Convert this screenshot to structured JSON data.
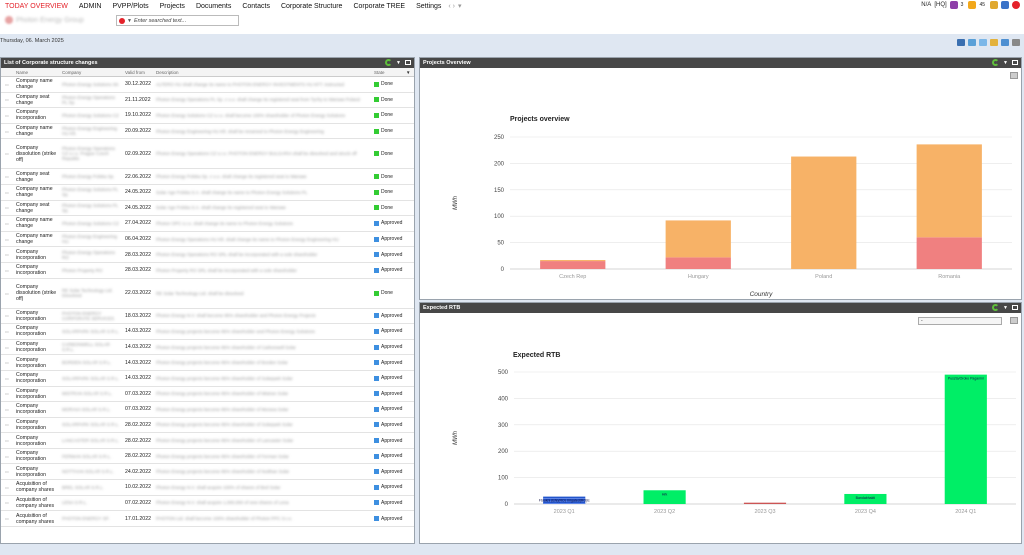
{
  "nav": {
    "items": [
      "TODAY OVERVIEW",
      "ADMIN",
      "PVPP/Plots",
      "Projects",
      "Documents",
      "Contacts",
      "Corporate Structure",
      "Corporate TREE",
      "Settings"
    ],
    "arrows": "‹ ›",
    "more_caret": "▾"
  },
  "topright": {
    "na": "N/A",
    "hq": "[HQ]",
    "count1": "3",
    "count2": "45"
  },
  "brand": {
    "name": "Photon Energy Group"
  },
  "search": {
    "placeholder": "Enter searched text..."
  },
  "date_line": "Thursday, 06. March 2025",
  "changes_panel": {
    "title": "List of Corporate structure changes",
    "columns": {
      "name": "Name",
      "company": "Company",
      "valid_from": "Valid from",
      "description": "Description",
      "state": "State"
    },
    "rows": [
      {
        "name": "Company name change",
        "company": "Photon Energy Solutions SK",
        "date": "30.12.2022",
        "desc": "ALTERO HU shall change its name to PHOTON ENERGY INVESTMENTS HU KFT. instructed",
        "state": "Done"
      },
      {
        "name": "Company seat change",
        "company": "Photon Energy Operations PL Sp.",
        "date": "21.11.2022",
        "desc": "Photon Energy Operations PL Sp. z o.o. shall change its registered seat from Tychy to Warsaw Poland",
        "state": "Done"
      },
      {
        "name": "Company incorporation",
        "company": "Photon Energy Solutions CZ",
        "date": "19.10.2022",
        "desc": "Photon Energy Solutions CZ s.r.o. shall become 100% shareholder of Photon Energy Solutions",
        "state": "Done"
      },
      {
        "name": "Company name change",
        "company": "Photon Energy Engineering HU Kft.",
        "date": "20.09.2022",
        "desc": "Photon Energy Engineering HU Kft. shall be renamed to Photon Energy Engineering",
        "state": "Done"
      },
      {
        "name": "Company dissolution (strike off)",
        "company": "Photon Energy Operations CZ s.r.o. Prague Czech Republic",
        "date": "02.09.2022",
        "desc": "Photon Energy Operations CZ s.r.o. PHOTON ENERGY BULGARIA shall be dissolved and struck off",
        "state": "Done",
        "tall": true
      },
      {
        "name": "Company seat change",
        "company": "Photon Energy Polska Sp.",
        "date": "22.06.2022",
        "desc": "Photon Energy Polska Sp. z o.o. shall change its registered seat to Warsaw",
        "state": "Done"
      },
      {
        "name": "Company name change",
        "company": "Photon Energy Solutions PL Sp.",
        "date": "24.05.2022",
        "desc": "Solar Age Polska S.A. shall change its name to Photon Energy Solutions PL",
        "state": "Done"
      },
      {
        "name": "Company seat change",
        "company": "Photon Energy Solutions PL Sp.",
        "date": "24.05.2022",
        "desc": "Solar Age Polska S.A. shall change its registered seat to Warsaw",
        "state": "Done"
      },
      {
        "name": "Company name change",
        "company": "Photon Energy Solutions CZ",
        "date": "27.04.2022",
        "desc": "Photon OPC s.r.o. shall change its name to Photon Energy Solutions",
        "state": "Approved"
      },
      {
        "name": "Company name change",
        "company": "Photon Energy Engineering HU",
        "date": "06.04.2022",
        "desc": "Photon Energy Operations HU Kft. shall change its name to Photon Energy Engineering HU",
        "state": "Approved"
      },
      {
        "name": "Company incorporation",
        "company": "Photon Energy Operations RO",
        "date": "28.03.2022",
        "desc": "Photon Energy Operations RO SRL shall be incorporated with a sole shareholder",
        "state": "Approved"
      },
      {
        "name": "Company incorporation",
        "company": "Photon Property RO",
        "date": "28.03.2022",
        "desc": "Photon Property RO SRL shall be incorporated with a sole shareholder",
        "state": "Approved"
      },
      {
        "name": "Company dissolution (strike off)",
        "company": "RE Solar Technology Ltd. Dissolved",
        "date": "22.03.2022",
        "desc": "RE Solar Technology Ltd. shall be dissolved",
        "state": "Done",
        "tall": true
      },
      {
        "name": "Company incorporation",
        "company": "PHOTON ENERGY CORPORATE SERVICES",
        "date": "18.03.2022",
        "desc": "Photon Energy N.V. shall become 95% shareholder and Photon Energy Projects",
        "state": "Approved"
      },
      {
        "name": "Company incorporation",
        "company": "SOLARPARK SOLAR S.R.L.",
        "date": "14.03.2022",
        "desc": "Photon Energy projects become 95% shareholder and Photon Energy Solutions",
        "state": "Approved"
      },
      {
        "name": "Company incorporation",
        "company": "CARBONWELL SOLAR S.R.L.",
        "date": "14.03.2022",
        "desc": "Photon Energy projects become 95% shareholder of Carbonwell Solar",
        "state": "Approved"
      },
      {
        "name": "Company incorporation",
        "company": "BORDEN SOLAR S.R.L.",
        "date": "14.03.2022",
        "desc": "Photon Energy projects become 95% shareholder of Borden Solar",
        "state": "Approved"
      },
      {
        "name": "Company incorporation",
        "company": "SOLARPARK SOLAR S.R.L.",
        "date": "14.03.2022",
        "desc": "Photon Energy projects become 95% shareholder of Solarpark Solar",
        "state": "Approved"
      },
      {
        "name": "Company incorporation",
        "company": "MISTRAN SOLAR S.R.L.",
        "date": "07.03.2022",
        "desc": "Photon Energy projects become 95% shareholder of Mistran Solar",
        "state": "Approved"
      },
      {
        "name": "Company incorporation",
        "company": "MORAVA SOLAR S.R.L.",
        "date": "07.03.2022",
        "desc": "Photon Energy projects become 95% shareholder of Morava Solar",
        "state": "Approved"
      },
      {
        "name": "Company incorporation",
        "company": "SOLARPARK SOLAR S.R.L.",
        "date": "28.02.2022",
        "desc": "Photon Energy projects become 95% shareholder of Solarpark Solar",
        "state": "Approved"
      },
      {
        "name": "Company incorporation",
        "company": "LANCASTER SOLAR S.R.L.",
        "date": "28.02.2022",
        "desc": "Photon Energy projects become 95% shareholder of Lancaster Solar",
        "state": "Approved"
      },
      {
        "name": "Company incorporation",
        "company": "FERMAN SOLAR S.R.L.",
        "date": "28.02.2022",
        "desc": "Photon Energy projects become 95% shareholder of Ferman Solar",
        "state": "Approved"
      },
      {
        "name": "Company incorporation",
        "company": "NOTTHAN SOLAR S.R.L.",
        "date": "24.02.2022",
        "desc": "Photon Energy projects become 95% shareholder of Notthan Solar",
        "state": "Approved"
      },
      {
        "name": "Acquisition of company shares",
        "company": "BREL SOLAR S.R.L.",
        "date": "10.02.2022",
        "desc": "Photon Energy N.V. shall acquire 100% of shares of Brel Solar",
        "state": "Approved"
      },
      {
        "name": "Acquisition of company shares",
        "company": "LENA S.R.L.",
        "date": "07.02.2022",
        "desc": "Photon Energy N.V. shall acquire 1,000,000 of new shares of Lena",
        "state": "Approved"
      },
      {
        "name": "Acquisition of company shares",
        "company": "PHOTON ENERGY SP.",
        "date": "17.01.2022",
        "desc": "PHOTON Ltd. shall become 100% shareholder of Photon PPC S.r.o.",
        "state": "Approved"
      }
    ]
  },
  "state_colors": {
    "Done": "#33cc33",
    "Approved": "#3d8fe0"
  },
  "projects_panel": {
    "title": "Projects Overview",
    "chart_data": {
      "type": "bar",
      "title": "Projects overview",
      "xlabel": "Country",
      "ylabel": "MWh",
      "categories": [
        "Czech Rep",
        "Hungary",
        "Poland",
        "Romania"
      ],
      "stacked": true,
      "series": [
        {
          "color": "#f08080",
          "values": [
            15,
            22,
            0,
            60
          ]
        },
        {
          "color": "#f7b267",
          "values": [
            2,
            70,
            213,
            176
          ]
        }
      ],
      "ylim": [
        0,
        250
      ],
      "yticks": [
        0,
        50,
        100,
        150,
        200,
        250
      ],
      "grid": true,
      "legend": "none"
    }
  },
  "rtb_panel": {
    "title": "Expected RTB",
    "select_value": "-",
    "chart_data": {
      "type": "bar",
      "title": "Expected RTB",
      "ylabel": "MWh",
      "categories": [
        "2023 Q1",
        "2023 Q2",
        "2023 Q3",
        "2023 Q4",
        "2024 Q1"
      ],
      "series": [
        {
          "color": "#2255cc",
          "values": [
            28,
            0,
            0,
            0,
            0
          ]
        },
        {
          "color": "#00ee66",
          "values": [
            0,
            52,
            0,
            38,
            490
          ]
        },
        {
          "color": "#cc5555",
          "values": [
            0,
            0,
            5,
            0,
            0
          ]
        }
      ],
      "bar_labels": [
        "Ftoukni (EN)(RO) Irrigated(RO)E",
        "Hrk",
        "",
        "Bandabhakti",
        "Puszta/Oroko Paganini"
      ],
      "ylim": [
        0,
        500
      ],
      "yticks": [
        0,
        100,
        200,
        300,
        400,
        500
      ],
      "grid": true,
      "legend": "none"
    }
  }
}
